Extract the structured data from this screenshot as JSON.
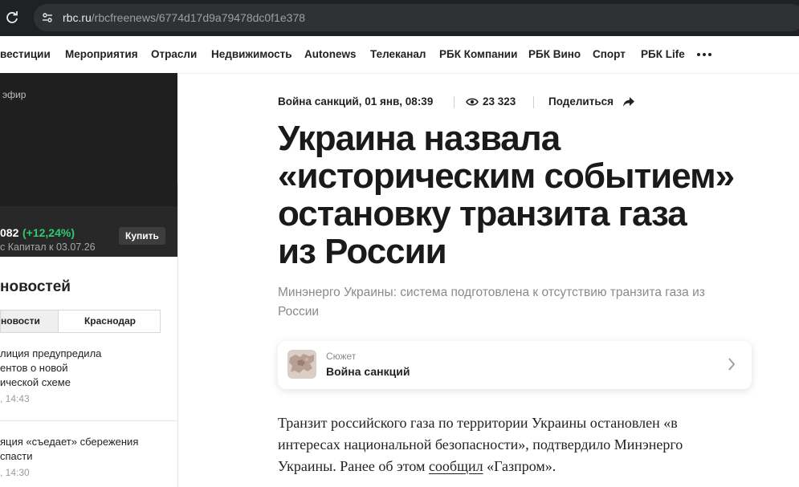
{
  "browser": {
    "url_domain": "rbc.ru",
    "url_path": "/rbcfreenews/6774d17d9a79478dc0f1e378"
  },
  "nav": {
    "items": [
      "вестиции",
      "Мероприятия",
      "Отрасли",
      "Недвижимость",
      "Autonews",
      "Телеканал",
      "РБК Компании",
      "РБК Вино",
      "Спорт",
      "РБК Life"
    ]
  },
  "sidebar": {
    "live_label": "эфир",
    "promo": {
      "value": "082",
      "change": "(+12,24%)",
      "subtitle": "с Капитал к 03.07.26",
      "buy_label": "Купить"
    },
    "feed_title": "новостей",
    "tabs": [
      "новости",
      "Краснодар"
    ],
    "items": [
      {
        "lines": [
          "лиция предупредила",
          "ентов о новой",
          "ической схеме"
        ],
        "time": ", 14:43"
      },
      {
        "lines": [
          "яция «съедает» сбережения",
          "спасти"
        ],
        "time": ", 14:30"
      }
    ]
  },
  "article": {
    "rubric": "Война санкций, 01 янв, 08:39",
    "views": "23 323",
    "share_label": "Поделиться",
    "headline_lines": [
      "Украина назвала",
      "«историческим событием»",
      "остановку транзита газа",
      "из России"
    ],
    "subtitle_lines": [
      "Минэнерго Украины: система подготовлена к отсутствию транзита газа из",
      "России"
    ],
    "story": {
      "label": "Сюжет",
      "title": "Война санкций"
    },
    "body": {
      "line1": "Транзит российского газа по территории Украины остановлен «в",
      "line2": "интересах национальной безопасности», подтвердило Минэнерго",
      "line3_pre": "Украины. Ранее об этом ",
      "line3_link": "сообщил",
      "line3_post": " «Газпром»."
    }
  },
  "colors": {
    "browser_bg": "#202124",
    "url_pill": "#303134",
    "positive": "#2ecc71",
    "headline": "#1a1a1a",
    "muted": "#8a8a8a"
  }
}
